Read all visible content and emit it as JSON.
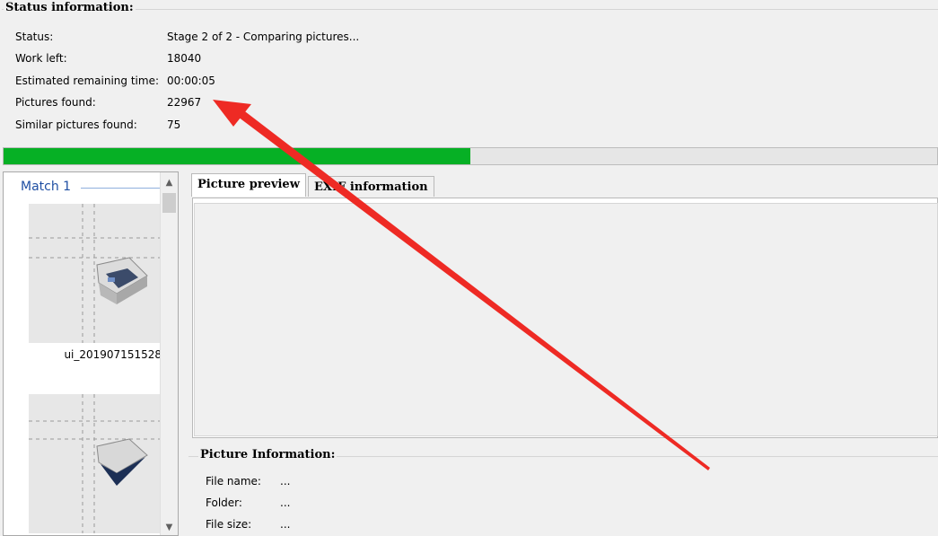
{
  "status_group": {
    "title": "Status information:",
    "rows": [
      {
        "label": "Status:",
        "value": "Stage 2 of 2 - Comparing pictures..."
      },
      {
        "label": "Work left:",
        "value": "18040"
      },
      {
        "label": "Estimated remaining time:",
        "value": "00:00:05"
      },
      {
        "label": "Pictures found:",
        "value": "22967"
      },
      {
        "label": "Similar pictures found:",
        "value": "75"
      }
    ]
  },
  "progress": {
    "fraction": 0.5,
    "fill_color": "#06b025"
  },
  "matches": {
    "header": "Match 1",
    "items": [
      {
        "caption": "ui_201907151528"
      },
      {
        "caption": ""
      }
    ]
  },
  "tabs": [
    {
      "label": "Picture preview",
      "active": true
    },
    {
      "label": "EXIF information",
      "active": false
    }
  ],
  "picture_info": {
    "title": "Picture Information:",
    "rows": [
      {
        "label": "File name:",
        "value": "..."
      },
      {
        "label": "Folder:",
        "value": "..."
      },
      {
        "label": "File size:",
        "value": "..."
      }
    ]
  },
  "annotation": {
    "color": "#ee2a24"
  }
}
